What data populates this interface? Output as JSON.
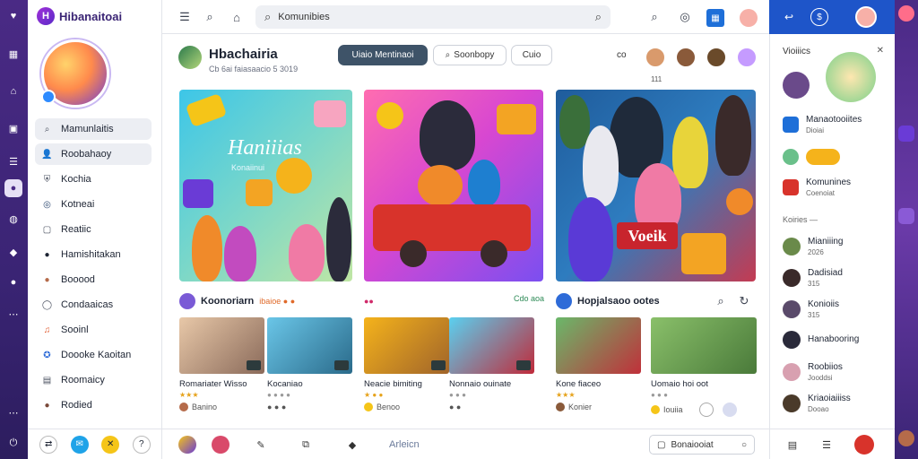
{
  "brand": {
    "name": "Hibanaitoai",
    "logo_letter": "H"
  },
  "topbar": {
    "search_value": "Komunibies"
  },
  "sidebar": {
    "items": [
      {
        "label": "Mamunlaitis",
        "icon": "search-icon",
        "glyph": "⌕",
        "color": "#4a5160",
        "active": true
      },
      {
        "label": "Roobahaoy",
        "icon": "user-icon",
        "glyph": "👤",
        "color": "#6b3bd6",
        "active": true
      },
      {
        "label": "Kochia",
        "icon": "shield-icon",
        "glyph": "⛨",
        "color": "#4a5160",
        "active": false
      },
      {
        "label": "Kotneai",
        "icon": "globe-icon",
        "glyph": "◎",
        "color": "#2e4a72",
        "active": false
      },
      {
        "label": "Reatiic",
        "icon": "doc-icon",
        "glyph": "▢",
        "color": "#4a5160",
        "active": false
      },
      {
        "label": "Hamishitakan",
        "icon": "circle-icon",
        "glyph": "●",
        "color": "#1d2433",
        "active": false
      },
      {
        "label": "Booood",
        "icon": "avatar-icon",
        "glyph": "●",
        "color": "#b56b4a",
        "active": false
      },
      {
        "label": "Condaaicas",
        "icon": "bubble-icon",
        "glyph": "◯",
        "color": "#4a5160",
        "active": false
      },
      {
        "label": "Sooinl",
        "icon": "music-icon",
        "glyph": "♫",
        "color": "#e0572b",
        "active": false
      },
      {
        "label": "Doooke Kaoitan",
        "icon": "star-badge-icon",
        "glyph": "✪",
        "color": "#2e6bd8",
        "active": false
      },
      {
        "label": "Roomaicy",
        "icon": "page-icon",
        "glyph": "▤",
        "color": "#4a5160",
        "active": false
      },
      {
        "label": "Rodied",
        "icon": "avatar-icon",
        "glyph": "●",
        "color": "#7a4a3a",
        "active": false
      }
    ]
  },
  "header": {
    "title": "Hbachairia",
    "subtitle": "Cb 6ai faiasaacio 5 3019",
    "btn_primary": "Uiaio Mentinaoi",
    "btn_secondary": "Soonbopy",
    "btn_tertiary": "Cuio",
    "link_icon": "co",
    "members_caption": "111"
  },
  "hero": {
    "h1_title": "Haniiias",
    "h1_sub": "Konaiinui",
    "h3_badge": "Voeik"
  },
  "sections": [
    {
      "title": "Koonoriarn",
      "emoji_text": "ibaioe ● ●",
      "right": "Cdo aoa"
    },
    {
      "title": "",
      "emoji_text": "●●",
      "right": ""
    },
    {
      "title": "Hopjalsaoo ootes",
      "emoji_text": "",
      "right": ""
    }
  ],
  "cards": [
    {
      "title": "Romariater Wisso",
      "stars": "★★★",
      "meta": "Banino"
    },
    {
      "title": "Kocaniao",
      "stars": "● ● ● ●",
      "meta": "● ● ●"
    },
    {
      "title": "Neacie bimiting",
      "stars": "★ ● ●",
      "meta": "Benoo"
    },
    {
      "title": "Nonnaio ouinate",
      "stars": "● ● ●",
      "meta": "● ●"
    },
    {
      "title": "Kone fiaceo",
      "stars": "★★★",
      "meta": "Konier"
    },
    {
      "title": "Uomaio hoi oot",
      "stars": "● ● ●",
      "meta": "Iouiia"
    }
  ],
  "bottombar": {
    "label": "Arleicn",
    "field_value": "Bonaiooiat"
  },
  "rpanel": {
    "head": "Vioiiics",
    "items": [
      {
        "title": "Manaotooiites",
        "sub": "Dioiai"
      },
      {
        "title": "",
        "sub": ""
      },
      {
        "title": "Komunines",
        "sub": "Coenoiat"
      }
    ],
    "section": "Koiries —",
    "people": [
      {
        "name": "Mianiiing",
        "sub": "2026"
      },
      {
        "name": "Dadisiad",
        "sub": "315"
      },
      {
        "name": "Konioiis",
        "sub": "315"
      },
      {
        "name": "Hanabooring",
        "sub": ""
      },
      {
        "name": "Roobiios",
        "sub": "Jooddsi"
      },
      {
        "name": "Kriaoiaiiiss",
        "sub": "Dooao"
      }
    ]
  },
  "colors": {
    "accent": "#3a2474",
    "primary_button": "#3e5368",
    "right_top": "#1e55c9"
  }
}
